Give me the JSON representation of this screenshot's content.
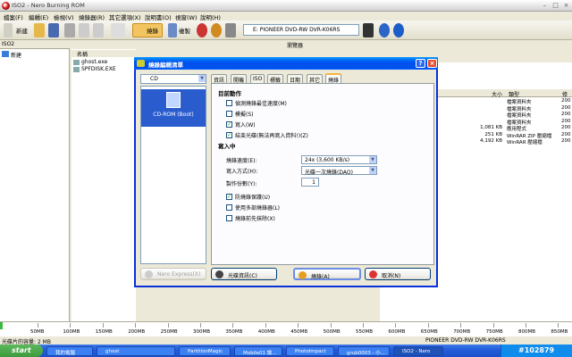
{
  "window": {
    "title": "ISO2 - Nero Burning ROM",
    "min": "–",
    "max": "□",
    "close": "×"
  },
  "menu": [
    "檔案(F)",
    "編輯(E)",
    "檢視(V)",
    "燒錄器(R)",
    "其它選項(X)",
    "說明書(O)",
    "視窗(W)",
    "說明(H)"
  ],
  "toolbar": {
    "new_label": "新建",
    "burn_label": "燒錄",
    "copy_label": "複製",
    "drive": "E: PIONEER DVD-RW DVR-K06RS"
  },
  "left": {
    "header": "ISO2",
    "root": "新建"
  },
  "middle": {
    "col_name": "名稱",
    "files": [
      "ghost.exe",
      "SPFDISK.EXE"
    ]
  },
  "right": {
    "header": "瀏覽器",
    "cols": {
      "size": "大小",
      "type": "類型",
      "mod": "修"
    },
    "rows": [
      {
        "size": "",
        "type": "檔案資料夾",
        "mod": "200"
      },
      {
        "size": "",
        "type": "檔案資料夾",
        "mod": "200"
      },
      {
        "size": "",
        "type": "檔案資料夾",
        "mod": "200"
      },
      {
        "size": "",
        "type": "檔案資料夾",
        "mod": "200"
      },
      {
        "size": "1,081 KB",
        "type": "應用程式",
        "mod": "200"
      },
      {
        "size": "251 KB",
        "type": "WinRAR ZIP 壓縮檔",
        "mod": "200"
      },
      {
        "size": "4,192 KB",
        "type": "WinRAR 壓縮檔",
        "mod": "200"
      }
    ]
  },
  "capacity": {
    "labels": [
      "50MB",
      "100MB",
      "150MB",
      "200MB",
      "250MB",
      "300MB",
      "350MB",
      "400MB",
      "450MB",
      "500MB",
      "550MB",
      "600MB",
      "650MB",
      "700MB",
      "750MB",
      "800MB",
      "850MB"
    ],
    "used_fraction": 0.004
  },
  "status": {
    "left": "光碟片的容量: 2 MB",
    "right": "PIONEER  DVD-RW  DVR-K06RS"
  },
  "taskbar": {
    "start": "start",
    "tasks": [
      "我的電腦",
      "ghost",
      "PartitionMagic",
      "Mobile01 論...",
      "PhotoImpact",
      "grub0003 - 小...",
      "ISO2 - Nero"
    ],
    "tray": "#102879"
  },
  "dialog": {
    "title": "燒錄編輯清單",
    "help": "?",
    "close": "×",
    "disc_type": "CD",
    "list_item": "CD-ROM (Boot)",
    "tabs": [
      "資訊",
      "開機",
      "ISO",
      "標籤",
      "日期",
      "其它",
      "燒錄"
    ],
    "sec_action": "目前動作",
    "actions": [
      {
        "label": "偵測燒錄最佳速度(M)",
        "checked": false
      },
      {
        "label": "模擬(S)",
        "checked": false
      },
      {
        "label": "寫入(W)",
        "checked": true
      },
      {
        "label": "結束光碟(無法再寫入資料!)(Z)",
        "checked": true
      }
    ],
    "sec_write": "寫入中",
    "speed_label": "燒錄速度(E):",
    "speed_value": "24x (3,600 KB/s)",
    "method_label": "寫入方式(H):",
    "method_value": "光碟一次燒錄(DAO)",
    "copies_label": "製作份數(Y):",
    "copies_value": "1",
    "options": [
      {
        "label": "防燒錄保護(U)",
        "checked": true
      },
      {
        "label": "使用多部燒錄器(L)",
        "checked": false
      },
      {
        "label": "燒錄前先抹除(X)",
        "checked": false
      }
    ],
    "btn_express": "Nero Express(X)",
    "btn_info": "光碟資訊(C)",
    "btn_burn": "燒錄(A)",
    "btn_cancel": "取消(N)"
  }
}
